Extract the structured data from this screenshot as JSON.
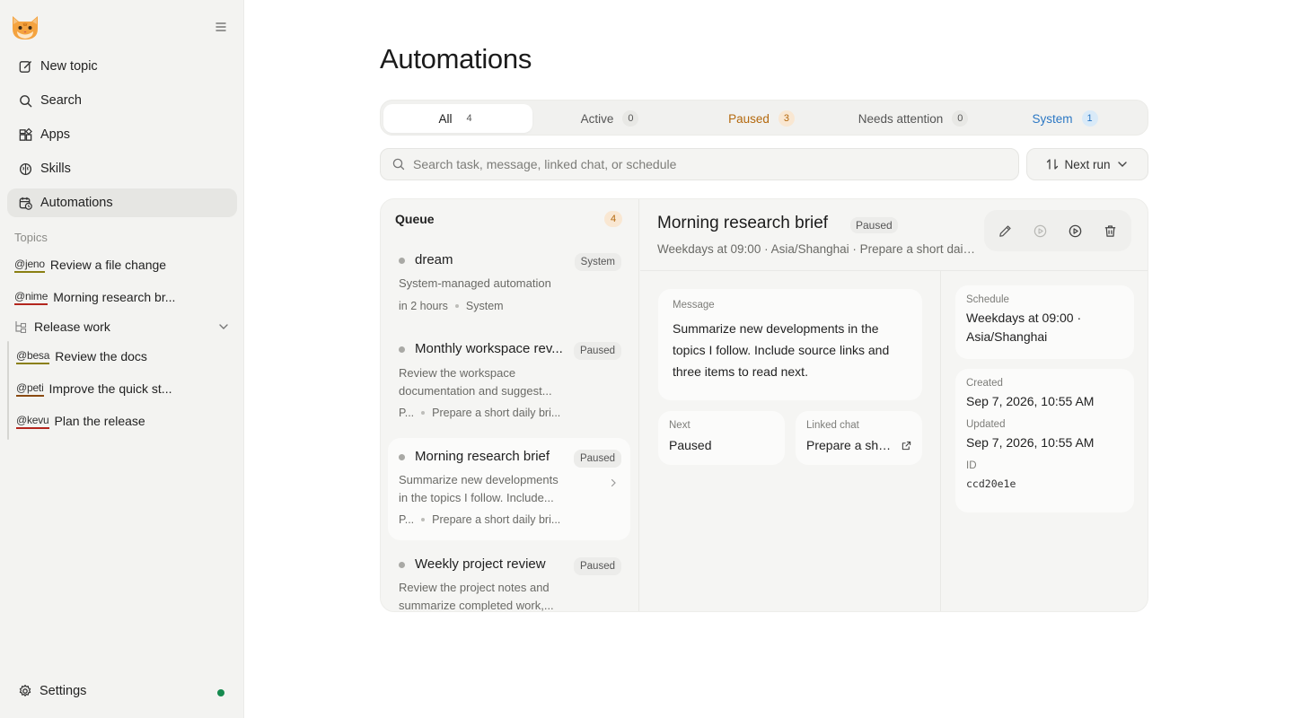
{
  "sidebar": {
    "nav": [
      {
        "label": "New topic",
        "icon": "edit-icon"
      },
      {
        "label": "Search",
        "icon": "search-icon"
      },
      {
        "label": "Apps",
        "icon": "apps-icon"
      },
      {
        "label": "Skills",
        "icon": "brain-icon"
      },
      {
        "label": "Automations",
        "icon": "calendar-clock-icon",
        "active": true
      }
    ],
    "topics_label": "Topics",
    "topics": [
      {
        "mention": "@jeno",
        "title": "Review a file change"
      },
      {
        "mention": "@nime",
        "title": "Morning research br..."
      }
    ],
    "group": {
      "label": "Release work",
      "items": [
        {
          "mention": "@besa",
          "title": "Review the docs"
        },
        {
          "mention": "@peti",
          "title": "Improve the quick st..."
        },
        {
          "mention": "@kevu",
          "title": "Plan the release"
        }
      ]
    },
    "settings_label": "Settings",
    "status_color": "#168a4f"
  },
  "page": {
    "title": "Automations"
  },
  "tabs": [
    {
      "label": "All",
      "count": "4"
    },
    {
      "label": "Active",
      "count": "0"
    },
    {
      "label": "Paused",
      "count": "3"
    },
    {
      "label": "Needs attention",
      "count": "0"
    },
    {
      "label": "System",
      "count": "1"
    }
  ],
  "search": {
    "placeholder": "Search task, message, linked chat, or schedule"
  },
  "sort": {
    "label": "Next run"
  },
  "queue": {
    "title": "Queue",
    "count": "4",
    "items": [
      {
        "title": "dream",
        "badge": "System",
        "desc": "System-managed automation",
        "meta1": "in 2 hours",
        "meta2": "System"
      },
      {
        "title": "Monthly workspace rev...",
        "badge": "Paused",
        "desc": "Review the workspace documentation and suggest...",
        "meta1": "P...",
        "meta2": "Prepare a short daily bri..."
      },
      {
        "title": "Morning research brief",
        "badge": "Paused",
        "desc": "Summarize new developments in the topics I follow. Include...",
        "meta1": "P...",
        "meta2": "Prepare a short daily bri..."
      },
      {
        "title": "Weekly project review",
        "badge": "Paused",
        "desc": "Review the project notes and summarize completed work,..."
      }
    ]
  },
  "detail": {
    "title": "Morning research brief",
    "status": "Paused",
    "subtitle": "Weekdays at 09:00 · Asia/Shanghai · Prepare a short daily...",
    "message_label": "Message",
    "message": "Summarize new developments in the topics I follow. Include source links and three items to read next.",
    "next_label": "Next",
    "next_value": "Paused",
    "linked_label": "Linked chat",
    "linked_value": "Prepare a shor...",
    "schedule_label": "Schedule",
    "schedule_value": "Weekdays at 09:00 · Asia/Shanghai",
    "created_label": "Created",
    "created_value": "Sep 7, 2026, 10:55 AM",
    "updated_label": "Updated",
    "updated_value": "Sep 7, 2026, 10:55 AM",
    "id_label": "ID",
    "id_value": "ccd20e1e"
  },
  "colors": {
    "accent_paused": "#b4690e",
    "accent_system": "#2c78c4",
    "sidebar_bg": "#f3f3f1"
  }
}
